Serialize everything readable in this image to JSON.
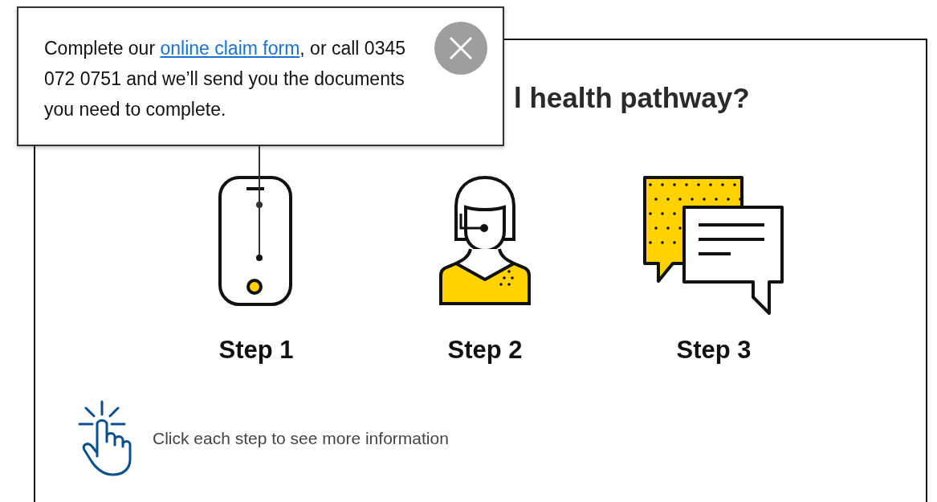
{
  "popup": {
    "text_before": "Complete our ",
    "link": "online claim form",
    "text_after": ", or call 0345 072 0751 and we’ll send you the documents you need to complete."
  },
  "heading": "l health pathway?",
  "steps": [
    {
      "label": "Step 1",
      "kind": "phone"
    },
    {
      "label": "Step 2",
      "kind": "agent"
    },
    {
      "label": "Step 3",
      "kind": "chat"
    }
  ],
  "hint": "Click each step to see more information"
}
